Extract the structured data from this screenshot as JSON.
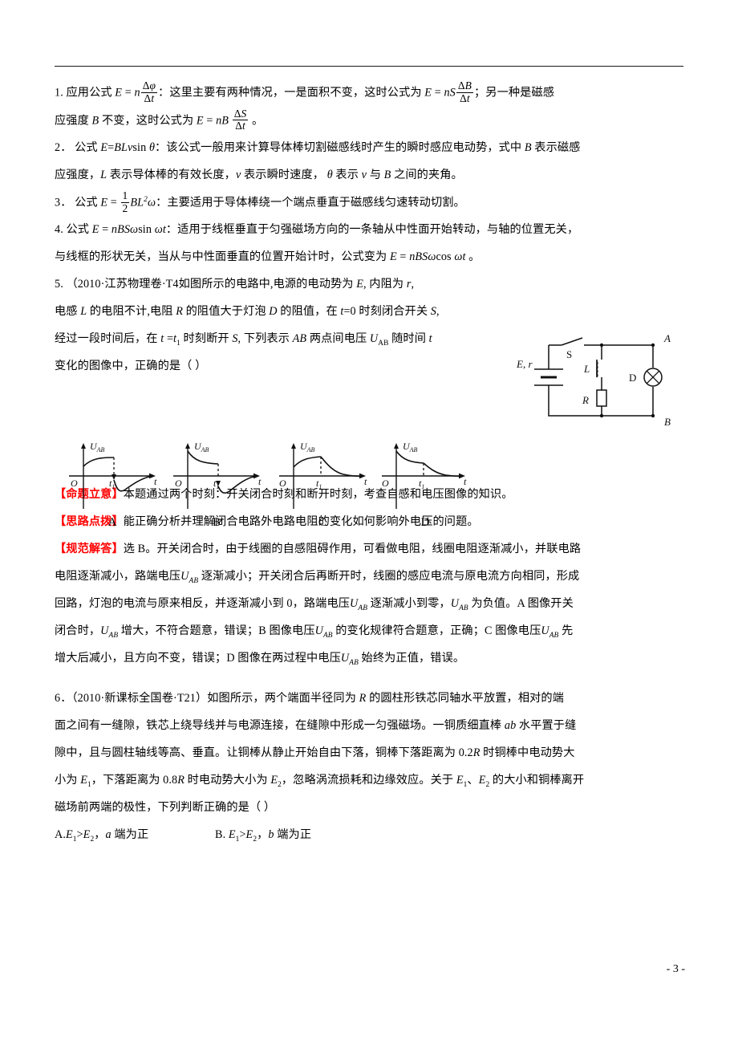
{
  "page": {
    "page_number": "- 3 -"
  },
  "items": [
    {
      "id": "item-1",
      "number": "1.",
      "text_parts": [
        "应用公式 E = n Δφ/Δt：这里主要有两种情况，一是面积不变，这时公式为 E = nS ΔB/Δt；另一种是磁感",
        "应强度 B 不变，这时公式为 E = nB ΔS/Δt 。"
      ]
    },
    {
      "id": "item-2",
      "number": "2．",
      "text_parts": [
        "公式 E=BLvsin θ：该公式一般用来计算导体棒切割磁感线时产生的瞬时感应电动势，式中 B 表示磁感",
        "应强度，L 表示导体棒的有效长度，v 表示瞬时速度， θ 表示 v 与 B 之间的夹角。"
      ]
    },
    {
      "id": "item-3",
      "number": "3．",
      "text_parts": [
        "公式 E = ½BL²ω：主要适用于导体棒绕一个端点垂直于磁感线匀速转动切割。"
      ]
    },
    {
      "id": "item-4",
      "number": "4.",
      "text_parts": [
        "公式 E = nBSωsin ωt：适用于线框垂直于匀强磁场方向的一条轴从中性面开始转动，与轴的位置无关，",
        "与线框的形状无关，当从与中性面垂直的位置开始计时，公式变为 E = nBSωcos ωt 。"
      ]
    }
  ],
  "q5": {
    "number": "5.",
    "source": "（2010·江苏物理卷·T4",
    "line1_a": "如图所示的电路中,电源的电动势为 ",
    "line1_b": ", 内阻为 ",
    "line2": "电感 L 的电阻不计,电阻 R 的阻值大于灯泡 D 的阻值，在 t=0 时刻闭合开关 S,",
    "line3": "经过一段时间后，在 t = t₁ 时刻断开 S, 下列表示 AB 两点间电压 U_AB 随时间 t",
    "line4": "变化的图像中，正确的是（      ）",
    "circuit": {
      "source_label": "E, r",
      "switch_label": "S",
      "inductor_label": "L",
      "resistor_label": "R",
      "lamp_label": "D",
      "node_a": "A",
      "node_b": "B"
    },
    "graphs": [
      {
        "label": "A",
        "y_axis": "U",
        "y_sub": "AB",
        "x_axis": "t",
        "origin": "O",
        "tick": "t",
        "tick_sub": "1",
        "shape": "rise-then-negative-recover"
      },
      {
        "label": "B",
        "y_axis": "U",
        "y_sub": "AB",
        "x_axis": "t",
        "origin": "O",
        "tick": "t",
        "tick_sub": "1",
        "shape": "decay-then-negative-recover"
      },
      {
        "label": "C",
        "y_axis": "U",
        "y_sub": "AB",
        "x_axis": "t",
        "origin": "O",
        "tick": "t",
        "tick_sub": "1",
        "shape": "rise-then-decay-positive"
      },
      {
        "label": "D",
        "y_axis": "U",
        "y_sub": "AB",
        "x_axis": "t",
        "origin": "O",
        "tick": "t",
        "tick_sub": "1",
        "shape": "decay-then-decay-positive"
      }
    ]
  },
  "annotations": [
    {
      "id": "intent",
      "tag": "【命题立意】",
      "body": "本题通过两个时刻：开关闭合时刻和断开时刻，考查自感和电压图像的知识。"
    },
    {
      "id": "hint",
      "tag": "【思路点拨】",
      "body": "能正确分析并理解闭合电路外电路电阻的变化如何影响外电压的问题。"
    },
    {
      "id": "solution",
      "tag": "【规范解答】",
      "body_lines": [
        "选 B。开关闭合时，由于线圈的自感阻碍作用，可看做电阻，线圈电阻逐渐减小，并联电路",
        "电阻逐渐减小，路端电压 U_AB 逐渐减小；开关闭合后再断开时，线圈的感应电流与原电流方向相同，形成",
        "回路，灯泡的电流与原来相反，并逐渐减小到 0，路端电压 U_AB 逐渐减小到零，U_AB 为负值。A 图像开关",
        "闭合时，U_AB 增大，不符合题意，错误；B 图像电压 U_AB 的变化规律符合题意，正确；C 图像电压 U_AB 先",
        "增大后减小，且方向不变，错误；D 图像在两过程中电压 U_AB 始终为正值，错误。"
      ]
    }
  ],
  "q6": {
    "number": "6．",
    "source": "（2010·新课标全国卷·T21）",
    "lines": [
      "如图所示，两个端面半径同为 R 的圆柱形铁芯同轴水平放置，相对的端",
      "面之间有一缝隙，铁芯上绕导线并与电源连接，在缝隙中形成一匀强磁场。一铜质细直棒 ab 水平置于缝",
      "隙中，且与圆柱轴线等高、垂直。让铜棒从静止开始自由下落，铜棒下落距离为 0.2R 时铜棒中电动势大",
      "小为 E₁，下落距离为 0.8R 时电动势大小为 E₂，忽略涡流损耗和边缘效应。关于 E₁、E₂ 的大小和铜棒离开",
      "磁场前两端的极性，下列判断正确的是（      ）"
    ],
    "options": [
      {
        "key": "A.",
        "text": "E₁>E₂，a 端为正"
      },
      {
        "key": "B.",
        "text": "E₁>E₂，b 端为正"
      }
    ]
  },
  "colors": {
    "tag_red": "#ff0000",
    "text_black": "#000000",
    "rule": "#1a1a1a"
  }
}
